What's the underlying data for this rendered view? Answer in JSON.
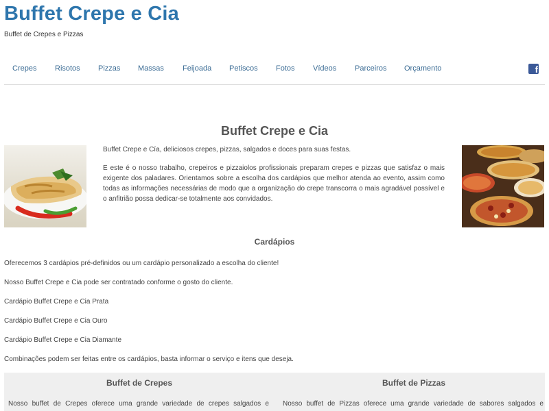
{
  "header": {
    "site_title": "Buffet Crepe e Cia",
    "tagline": "Buffet de Crepes e Pizzas"
  },
  "nav": {
    "items": [
      {
        "label": "Crepes"
      },
      {
        "label": "Risotos"
      },
      {
        "label": "Pizzas"
      },
      {
        "label": "Massas"
      },
      {
        "label": "Feijoada"
      },
      {
        "label": "Petiscos"
      },
      {
        "label": "Fotos"
      },
      {
        "label": "Vídeos"
      },
      {
        "label": "Parceiros"
      },
      {
        "label": "Orçamento"
      }
    ],
    "social_icon": "facebook-icon",
    "social_glyph": "f"
  },
  "main": {
    "heading": "Buffet Crepe e Cia",
    "crepe_image": "crepe-photo",
    "pizza_image": "pizza-photo",
    "intro_1": "Buffet Crepe e Cía, deliciosos crepes, pizzas, salgados e doces para suas festas.",
    "intro_2": "E este é o nosso trabalho, crepeiros e pizzaiolos profissionais preparam crepes e pizzas que satisfaz o mais exigente dos paladares. Orientamos sobre a escolha dos cardápios que melhor atenda ao evento, assim como todas as informações necessárias de modo que a organização do crepe transcorra o mais agradável possível e o anfitrião possa dedicar-se totalmente aos convidados.",
    "menus_heading": "Cardápios",
    "p1": "Oferecemos 3 cardápios pré-definidos ou um cardápio personalizado a escolha do cliente!",
    "p2": "Nosso Buffet Crepe e Cia pode ser contratado conforme o gosto do cliente.",
    "p3": "Cardápio Buffet Crepe e Cia Prata",
    "p4": "Cardápio Buffet Crepe e Cia Ouro",
    "p5": "Cardápio Buffet Crepe e Cia Diamante",
    "p6": "Combinações podem ser feitas entre os cardápios, basta informar o serviço e itens que deseja."
  },
  "boxes": {
    "crepes_title": "Buffet de Crepes",
    "crepes_text": "Nosso buffet de Crepes oferece uma grande variedade de crepes salgados e",
    "pizzas_title": "Buffet de Pizzas",
    "pizzas_text": "Nosso buffet de Pizzas oferece uma grande variedade de sabores salgados e"
  },
  "colors": {
    "title": "#2e76ad",
    "nav_link": "#3a6b94",
    "facebook": "#3b5998",
    "box_bg": "#efefef"
  }
}
